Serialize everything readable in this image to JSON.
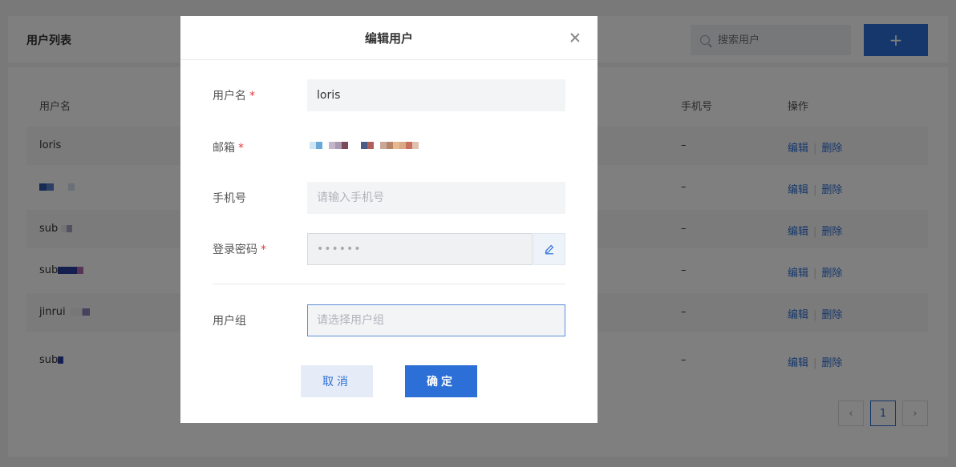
{
  "page": {
    "title": "用户列表",
    "search_placeholder": "搜索用户",
    "add_label": "+"
  },
  "table": {
    "columns": {
      "name": "用户名",
      "phone": "手机号",
      "ops": "操作"
    },
    "rows": [
      {
        "name": "loris",
        "phone": "–",
        "edit": "编辑",
        "delete": "删除"
      },
      {
        "name": "",
        "phone": "–",
        "edit": "编辑",
        "delete": "删除"
      },
      {
        "name": "sub",
        "phone": "–",
        "edit": "编辑",
        "delete": "删除"
      },
      {
        "name": "sub",
        "phone": "–",
        "edit": "编辑",
        "delete": "删除"
      },
      {
        "name": "jinrui",
        "phone": "–",
        "edit": "编辑",
        "delete": "删除"
      },
      {
        "name": "sub",
        "phone": "–",
        "edit": "编辑",
        "delete": "删除"
      }
    ]
  },
  "pagination": {
    "current": "1",
    "prev": "‹",
    "next": "›"
  },
  "modal": {
    "title": "编辑用户",
    "fields": {
      "username": {
        "label": "用户名",
        "required": "*",
        "value": "loris"
      },
      "email": {
        "label": "邮箱",
        "required": "*"
      },
      "phone": {
        "label": "手机号",
        "placeholder": "请输入手机号"
      },
      "password": {
        "label": "登录密码",
        "required": "*",
        "value": "••••••"
      },
      "group": {
        "label": "用户组",
        "placeholder": "请选择用户组"
      }
    },
    "cancel_label": "取消",
    "ok_label": "确定"
  },
  "colors": {
    "accent": "#2c6fd6",
    "required": "#e03b3b"
  },
  "icons": {
    "close": "close-icon",
    "edit": "pencil-icon",
    "search": "search-icon"
  }
}
